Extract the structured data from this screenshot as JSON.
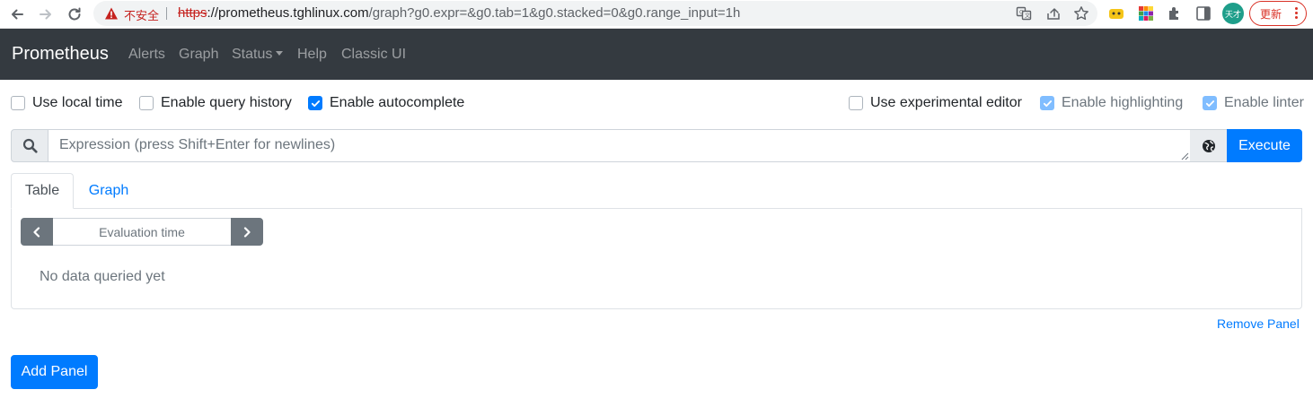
{
  "browser": {
    "insecure_label": "不安全",
    "url_scheme": "https",
    "url_host": "://prometheus.tghlinux.com",
    "url_path": "/graph?g0.expr=&g0.tab=1&g0.stacked=0&g0.range_input=1h",
    "profile_initials": "天才",
    "update_label": "更新"
  },
  "navbar": {
    "brand": "Prometheus",
    "links": [
      "Alerts",
      "Graph",
      "Status",
      "Help",
      "Classic UI"
    ]
  },
  "options": {
    "use_local_time": {
      "label": "Use local time",
      "checked": false
    },
    "enable_query_history": {
      "label": "Enable query history",
      "checked": false
    },
    "enable_autocomplete": {
      "label": "Enable autocomplete",
      "checked": true
    },
    "use_experimental_editor": {
      "label": "Use experimental editor",
      "checked": false
    },
    "enable_highlighting": {
      "label": "Enable highlighting",
      "checked": true
    },
    "enable_linter": {
      "label": "Enable linter",
      "checked": true
    }
  },
  "query": {
    "placeholder": "Expression (press Shift+Enter for newlines)",
    "value": "",
    "execute_label": "Execute"
  },
  "panel": {
    "tabs": [
      "Table",
      "Graph"
    ],
    "active_tab": "Table",
    "eval_time_placeholder": "Evaluation time",
    "no_data": "No data queried yet",
    "remove_label": "Remove Panel"
  },
  "add_panel_label": "Add Panel",
  "colors": {
    "navbar_bg": "#343a40",
    "primary": "#007bff",
    "secondary": "#6c757d",
    "insecure_red": "#c5221f"
  }
}
